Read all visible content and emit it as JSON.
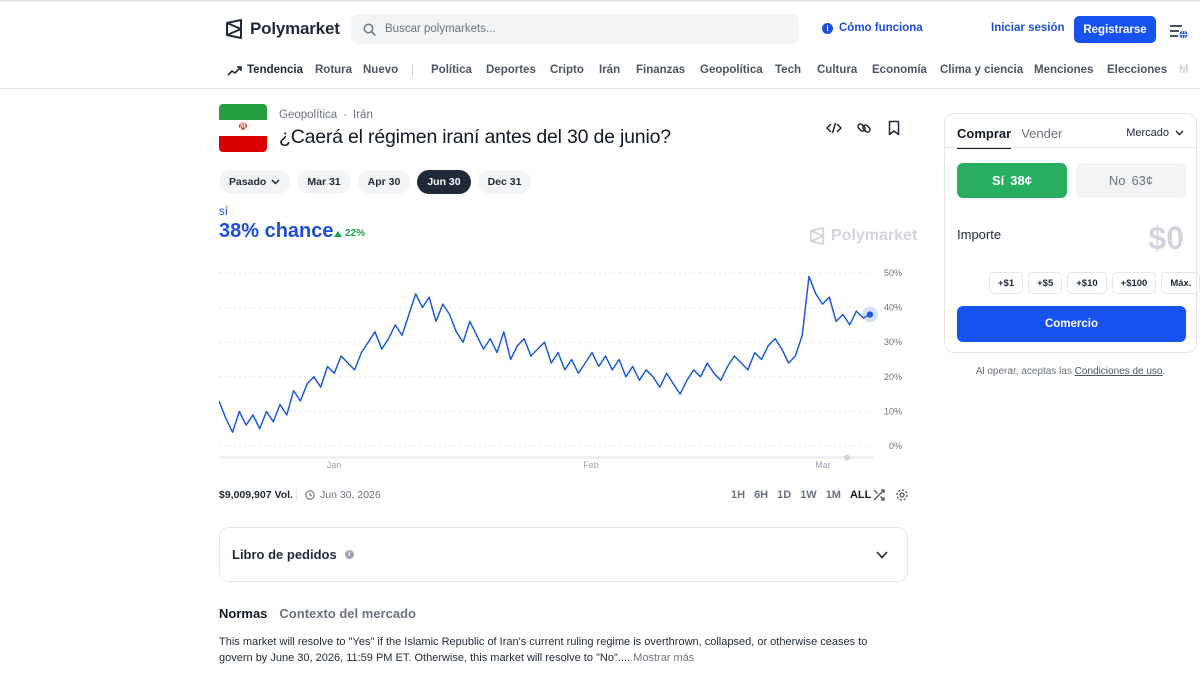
{
  "header": {
    "logo_text": "Polymarket",
    "search_placeholder": "Buscar polymarkets...",
    "how_it_works": "Cómo funciona",
    "login": "Iniciar sesión",
    "register": "Registrarse"
  },
  "nav": {
    "items": [
      "Tendencia",
      "Rotura",
      "Nuevo",
      "Política",
      "Deportes",
      "Cripto",
      "Irán",
      "Finanzas",
      "Geopolítica",
      "Tech",
      "Cultura",
      "Economía",
      "Clima y ciencia",
      "Menciones",
      "Elecciones",
      "M"
    ]
  },
  "market": {
    "breadcrumb": [
      "Geopolítica",
      "·",
      "Irán"
    ],
    "title": "¿Caerá el régimen iraní antes del 30 de junio?",
    "dates": [
      "Pasado",
      "Mar 31",
      "Apr 30",
      "Jun 30",
      "Dec 31"
    ],
    "active_date": "Jun 30",
    "outcome": "sí",
    "chance": "38% chance",
    "delta": "22%",
    "watermark": "Polymarket",
    "volume": "$9,009,907 Vol.",
    "end_date": "Jun 30, 2026",
    "ranges": [
      "1H",
      "6H",
      "1D",
      "1W",
      "1M",
      "ALL"
    ],
    "active_range": "ALL",
    "orderbook": "Libro de pedidos",
    "tabs": [
      "Normas",
      "Contexto del mercado"
    ],
    "rules_text": "This market will resolve to \"Yes\" if the Islamic Republic of Iran's current ruling regime is overthrown, collapsed, or otherwise ceases to govern by June 30, 2026, 11:59 PM ET. Otherwise, this market will resolve to \"No\"....",
    "show_more": "Mostrar más"
  },
  "trade": {
    "tab_buy": "Comprar",
    "tab_sell": "Vender",
    "order_type": "Mercado",
    "yes_label": "Sí",
    "yes_price": "38¢",
    "no_label": "No",
    "no_price": "63¢",
    "amount_label": "Importe",
    "amount_value": "$0",
    "chips": [
      "+$1",
      "+$5",
      "+$10",
      "+$100",
      "Máx."
    ],
    "trade_button": "Comercio",
    "terms_prefix": "Al operar, aceptas las",
    "terms_link": "Condiciones de uso",
    "terms_suffix": "."
  },
  "chart_data": {
    "type": "line",
    "series": [
      {
        "name": "",
        "color": "#1d5bd6",
        "values": [
          13,
          8,
          4,
          10,
          6,
          9,
          5,
          10,
          7,
          12,
          9,
          16,
          13,
          18,
          20,
          17,
          23,
          21,
          26,
          24,
          22,
          27,
          30,
          33,
          28,
          31,
          35,
          32,
          38,
          44,
          40,
          43,
          36,
          41,
          38,
          33,
          30,
          36,
          32,
          28,
          31,
          27,
          33,
          25,
          29,
          31,
          26,
          28,
          30,
          24,
          27,
          22,
          25,
          21,
          24,
          27,
          23,
          26,
          22,
          25,
          20,
          23,
          19,
          22,
          20,
          17,
          21,
          18,
          15,
          19,
          22,
          20,
          24,
          21,
          19,
          23,
          26,
          24,
          22,
          27,
          25,
          29,
          31,
          28,
          24,
          26,
          32,
          49,
          44,
          41,
          43,
          36,
          38,
          35,
          39,
          37,
          38
        ]
      }
    ],
    "x_ticks": [
      "Jan",
      "Feb",
      "Mar"
    ],
    "y_ticks": [
      "50%",
      "40%",
      "30%",
      "20%",
      "10%",
      "0%"
    ],
    "ylim": [
      0,
      50
    ],
    "last_value": 38
  }
}
